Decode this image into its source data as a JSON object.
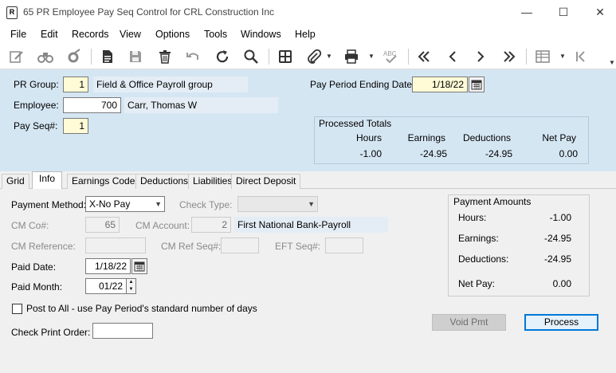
{
  "window": {
    "title": "65 PR Employee Pay Seq Control for CRL Construction Inc",
    "icon_glyph": "R",
    "minimize": "—",
    "maximize": "☐",
    "close": "✕"
  },
  "menu": [
    "File",
    "Edit",
    "Records",
    "View",
    "Options",
    "Tools",
    "Windows",
    "Help"
  ],
  "header": {
    "pr_group_label": "PR Group:",
    "pr_group_value": "1",
    "pr_group_desc": "Field & Office Payroll group",
    "employee_label": "Employee:",
    "employee_value": "700",
    "employee_desc": "Carr, Thomas W",
    "pay_seq_label": "Pay Seq#:",
    "pay_seq_value": "1",
    "ppe_label": "Pay Period Ending Date:",
    "ppe_value": "1/18/22"
  },
  "totals": {
    "title": "Processed Totals",
    "headers": [
      "Hours",
      "Earnings",
      "Deductions",
      "Net Pay"
    ],
    "values": [
      "-1.00",
      "-24.95",
      "-24.95",
      "0.00"
    ]
  },
  "tabs": [
    "Grid",
    "Info",
    "Earnings Codes",
    "Deductions",
    "Liabilities",
    "Direct Deposit"
  ],
  "info": {
    "payment_method_label": "Payment Method:",
    "payment_method_value": "X-No Pay",
    "check_type_label": "Check Type:",
    "check_type_value": "",
    "cm_co_label": "CM Co#:",
    "cm_co_value": "65",
    "cm_account_label": "CM Account:",
    "cm_account_value": "2",
    "cm_account_desc": "First National Bank-Payroll",
    "cm_reference_label": "CM Reference:",
    "cm_ref_seq_label": "CM Ref Seq#:",
    "eft_seq_label": "EFT Seq#:",
    "paid_date_label": "Paid Date:",
    "paid_date_value": "1/18/22",
    "paid_month_label": "Paid Month:",
    "paid_month_value": "01/22",
    "post_to_all_label": "Post to All - use Pay Period's standard number of days",
    "check_print_order_label": "Check Print Order:"
  },
  "payment_amounts": {
    "title": "Payment Amounts",
    "hours_label": "Hours:",
    "hours_value": "-1.00",
    "earnings_label": "Earnings:",
    "earnings_value": "-24.95",
    "deductions_label": "Deductions:",
    "deductions_value": "-24.95",
    "net_pay_label": "Net Pay:",
    "net_pay_value": "0.00"
  },
  "buttons": {
    "void_pmt": "Void Pmt",
    "process": "Process"
  },
  "colors": {
    "header_bg": "#d5e6f3",
    "required_field": "#fffbd6",
    "accent": "#0078d7"
  }
}
